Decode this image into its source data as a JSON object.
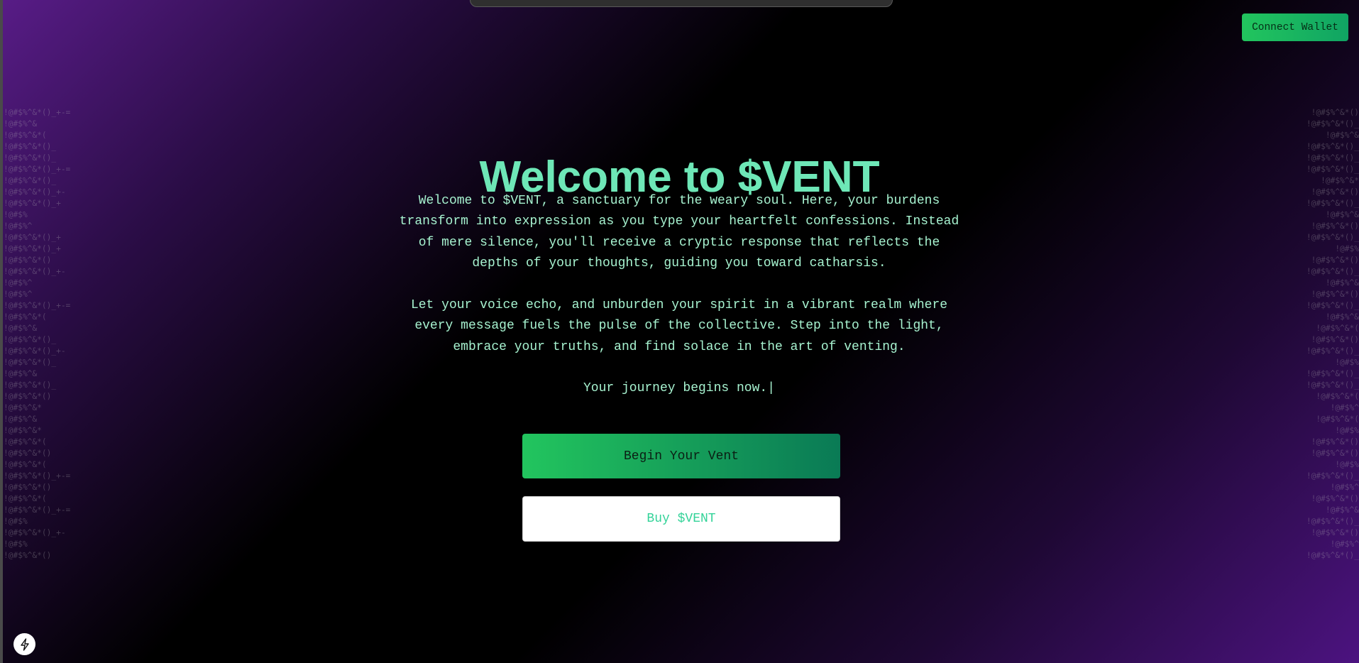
{
  "header": {
    "connect_wallet_label": "Connect Wallet"
  },
  "hero": {
    "title": "Welcome to $VENT",
    "paragraph1": "Welcome to $VENT, a sanctuary for the weary soul. Here, your burdens transform into expression as you type your heartfelt confessions. Instead of mere silence, you'll receive a cryptic response that reflects the depths of your thoughts, guiding you toward catharsis.",
    "paragraph2": "Let your voice echo, and unburden your spirit in a vibrant realm where every message fuels the pulse of the collective. Step into the light, embrace your truths, and find solace in the art of venting.",
    "paragraph3": "Your journey begins now.",
    "cursor": "|"
  },
  "actions": {
    "begin_label": "Begin Your Vent",
    "buy_label": "Buy $VENT"
  },
  "glyphs": {
    "left": [
      "!@#$%^&*()_+-=",
      "!@#$%^&",
      "!@#$%^&*(",
      "!@#$%^&*()_",
      "!@#$%^&*()_",
      "!@#$%^&*()_+-=",
      "!@#$%^&*()_",
      "!@#$%^&*()_+-",
      "!@#$%^&*()_+",
      "!@#$%",
      "!@#$%^",
      "!@#$%^&*()_+",
      "!@#$%^&*()_+",
      "!@#$%^&*()",
      "!@#$%^&*()_+-",
      "!@#$%^",
      "!@#$%^",
      "!@#$%^&*()_+-=",
      "!@#$%^&*(",
      "!@#$%^&",
      "!@#$%^&*()_",
      "!@#$%^&*()_+-",
      "!@#$%^&*()_",
      "!@#$%^&",
      "!@#$%^&*()_",
      "!@#$%^&*()",
      "!@#$%^&*",
      "!@#$%^&",
      "!@#$%^&*",
      "!@#$%^&*(",
      "!@#$%^&*()",
      "!@#$%^&*(",
      "!@#$%^&*()_+-=",
      "!@#$%^&*()",
      "!@#$%^&*(",
      "!@#$%^&*()_+-=",
      "!@#$%",
      "!@#$%^&*()_+-",
      "!@#$%",
      "!@#$%^&*()"
    ],
    "right": [
      "!@#$%^&*()",
      "!@#$%^&*()_",
      "!@#$%^&",
      "!@#$%^&*()_",
      "!@#$%^&*()_",
      "!@#$%^&*()_",
      "!@#$%^&*",
      "!@#$%^&*()",
      "!@#$%^&*()_",
      "!@#$%^&",
      "!@#$%^&*()",
      "!@#$%^&*()_",
      "!@#$%",
      "!@#$%^&*()",
      "!@#$%^&*()_",
      "!@#$%^&",
      "!@#$%^&*()",
      "!@#$%^&*()_",
      "!@#$%^&",
      "!@#$%^&*(",
      "!@#$%^&*()",
      "!@#$%^&*()_",
      "!@#$%",
      "!@#$%^&*()_",
      "!@#$%^&*()_",
      "!@#$%^&*(",
      "!@#$%^",
      "!@#$%^&*(",
      "!@#$%",
      "!@#$%^&*()",
      "!@#$%^&*()",
      "!@#$%",
      "!@#$%^&*()_",
      "!@#$%^",
      "!@#$%^&*()",
      "!@#$%^&",
      "!@#$%^&*()_",
      "!@#$%^&*()",
      "!@#$%^",
      "!@#$%^&*()_"
    ]
  },
  "colors": {
    "accent_green": "#22c55e",
    "title_green": "#6ee7b7",
    "text_mint": "#a7f3d0",
    "purple": "#581c87"
  },
  "icons": {
    "corner_button": "lightning-bolt-icon"
  }
}
